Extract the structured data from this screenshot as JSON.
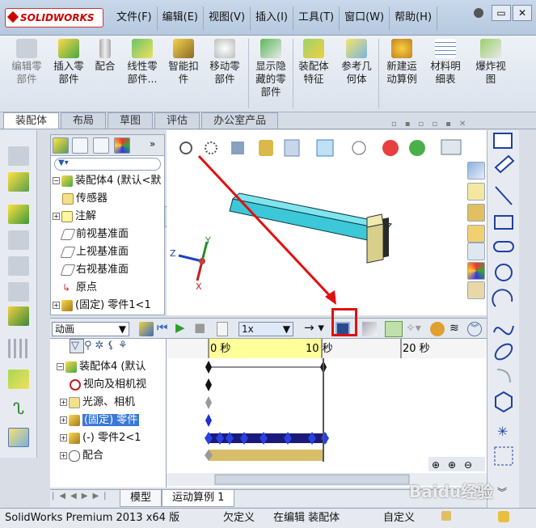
{
  "app": {
    "logo_text": "SOLIDWORKS"
  },
  "menu": [
    "文件(F)",
    "编辑(E)",
    "视图(V)",
    "插入(I)",
    "工具(T)",
    "窗口(W)",
    "帮助(H)"
  ],
  "ribbon": [
    {
      "label": "编辑零\n部件",
      "icon": "edit-component-icon"
    },
    {
      "label": "插入零\n部件",
      "icon": "insert-component-icon"
    },
    {
      "label": "配合",
      "icon": "mate-icon"
    },
    {
      "label": "线性零\n部件...",
      "icon": "linear-pattern-icon"
    },
    {
      "label": "智能扣\n件",
      "icon": "smart-fastener-icon"
    },
    {
      "label": "移动零\n部件",
      "icon": "move-component-icon"
    },
    {
      "label": "显示隐\n藏的零\n部件",
      "icon": "show-hidden-icon"
    },
    {
      "label": "装配体\n特征",
      "icon": "assembly-feature-icon"
    },
    {
      "label": "参考几\n何体",
      "icon": "reference-geometry-icon"
    },
    {
      "label": "新建运\n动算例",
      "icon": "new-motion-study-icon"
    },
    {
      "label": "材料明\n细表",
      "icon": "bom-icon"
    },
    {
      "label": "爆炸视\n图",
      "icon": "exploded-view-icon"
    }
  ],
  "tabs": [
    "装配体",
    "布局",
    "草图",
    "评估",
    "办公室产品"
  ],
  "feature_tree": [
    {
      "label": "装配体4 (默认<默",
      "icon": "assembly-icon"
    },
    {
      "label": "传感器",
      "icon": "sensor-icon"
    },
    {
      "label": "注解",
      "icon": "annotation-icon"
    },
    {
      "label": "前视基准面",
      "icon": "plane-icon"
    },
    {
      "label": "上视基准面",
      "icon": "plane-icon"
    },
    {
      "label": "右视基准面",
      "icon": "plane-icon"
    },
    {
      "label": "原点",
      "icon": "origin-icon"
    },
    {
      "label": "(固定) 零件1<1",
      "icon": "part-icon"
    }
  ],
  "axes": {
    "x": "X",
    "y": "Y",
    "z": "Z"
  },
  "motion": {
    "study_type": "动画",
    "speed": "1x",
    "tree": [
      {
        "label": "装配体4 (默认",
        "icon": "assembly-icon"
      },
      {
        "label": "视向及相机视",
        "icon": "camera-icon"
      },
      {
        "label": "光源、相机",
        "icon": "lights-icon"
      },
      {
        "label": "(固定) 零件",
        "icon": "part-icon"
      },
      {
        "label": "(-) 零件2<1",
        "icon": "part-icon"
      },
      {
        "label": "配合",
        "icon": "mate-icon"
      }
    ],
    "time_labels": [
      "0 秒",
      "10 秒",
      "20 秒"
    ]
  },
  "bottom_tabs": [
    "模型",
    "运动算例 1"
  ],
  "status": {
    "product": "SolidWorks Premium 2013 x64 版",
    "state1": "欠定义",
    "state2": "在编辑 装配体",
    "state3": "自定义"
  },
  "watermark": "Baidu经验",
  "colors": {
    "highlight": "#e01010",
    "timeline_band": "#ffff99",
    "part_cyan": "#3cc8d8",
    "part_yellow": "#d8d08a"
  }
}
